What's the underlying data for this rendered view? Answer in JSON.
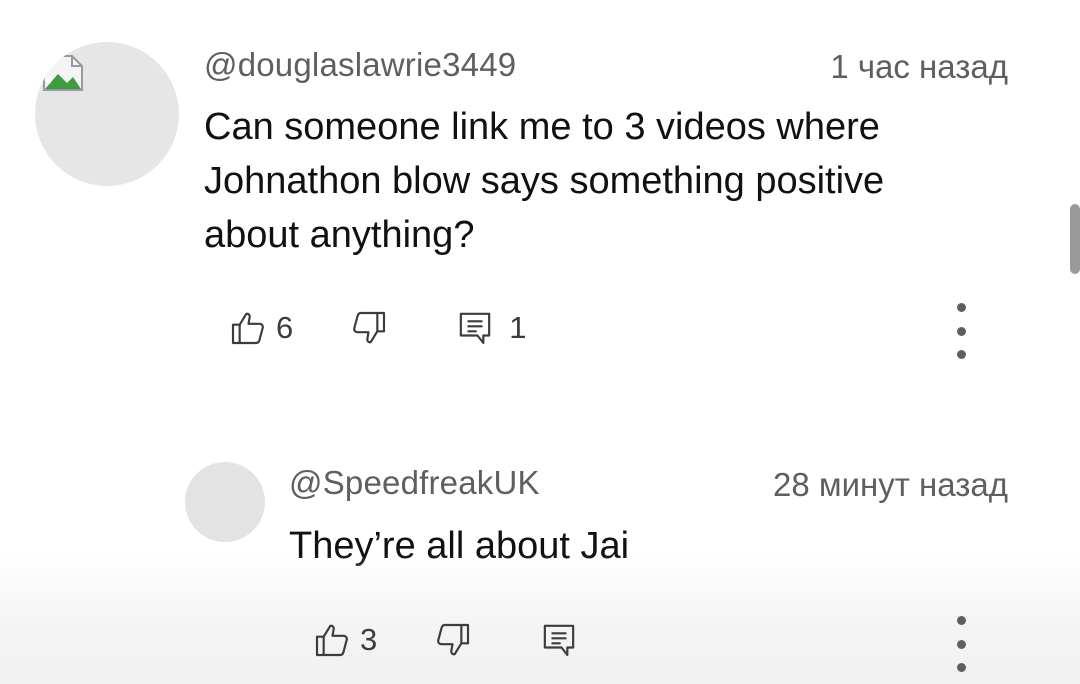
{
  "comments": [
    {
      "author": "@douglaslawrie3449",
      "time": "1 час назад",
      "text_lines": [
        "Can someone link me to 3 videos where",
        "Johnathon blow says something positive",
        "about anything?"
      ],
      "likes": "6",
      "replies": "1"
    },
    {
      "author": "@SpeedfreakUK",
      "time": "28 минут назад",
      "text_lines": [
        "They’re all about Jai"
      ],
      "likes": "3"
    }
  ],
  "icons": {
    "like": "thumbs-up-icon",
    "dislike": "thumbs-down-icon",
    "reply": "reply-comment-icon",
    "more": "more-vertical-icon",
    "broken_avatar": "broken-image-icon"
  },
  "colors": {
    "text": "#111111",
    "meta": "#5f5f5f",
    "avatar": "#e6e6e6",
    "scrollbar": "#9a9a9a"
  }
}
